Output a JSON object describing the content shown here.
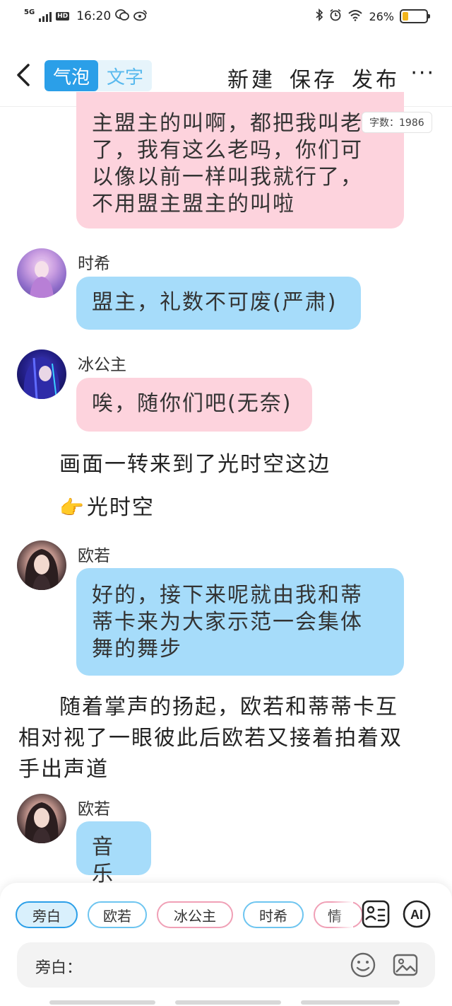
{
  "status_bar": {
    "network": "5G",
    "hd_badge": "HD",
    "time": "16:20",
    "battery_pct": "26%",
    "battery_level": 0.26,
    "battery_color": "#f2b51c"
  },
  "header": {
    "segments": [
      {
        "label": "气泡",
        "active": true
      },
      {
        "label": "文字",
        "active": false
      }
    ],
    "actions": {
      "new": "新建",
      "save": "保存",
      "publish": "发布"
    },
    "more": "···"
  },
  "char_count": "字数：1986",
  "messages": [
    {
      "type": "bubble",
      "color": "pink",
      "lines": [
        "主盟主的叫啊，都把我叫老",
        "了，我有这么老吗，你们可",
        "以像以前一样叫我就行了，",
        "不用盟主盟主的叫啦"
      ]
    },
    {
      "type": "bubble",
      "name": "时希",
      "color": "blue",
      "lines": [
        "盟主，礼数不可废(严肃)"
      ]
    },
    {
      "type": "bubble",
      "name": "冰公主",
      "color": "pink",
      "lines": [
        "唉，随你们吧(无奈)"
      ]
    },
    {
      "type": "narration",
      "lines": [
        "画面一转来到了光时空这边"
      ]
    },
    {
      "type": "narration",
      "emoji": "👉",
      "lines": [
        "光时空"
      ]
    },
    {
      "type": "bubble",
      "name": "欧若",
      "color": "blue",
      "lines": [
        "好的，接下来呢就由我和蒂",
        "蒂卡来为大家示范一会集体",
        "舞的舞步"
      ]
    },
    {
      "type": "narration",
      "lines": [
        "随着掌声的扬起，欧若和蒂蒂卡互",
        "相对视了一眼彼此后欧若又接着拍着双",
        "手出声道"
      ]
    },
    {
      "type": "bubble",
      "name": "欧若",
      "color": "blue",
      "lines": [
        "音乐"
      ]
    }
  ],
  "roles": [
    "旁白",
    "欧若",
    "冰公主",
    "时希",
    "情"
  ],
  "selected_role": "旁白",
  "input": {
    "label": "旁白：",
    "value": ""
  },
  "colors": {
    "accent": "#2b9fe8",
    "pink_bubble": "#fdd3dd",
    "blue_bubble": "#a6dcfa"
  }
}
